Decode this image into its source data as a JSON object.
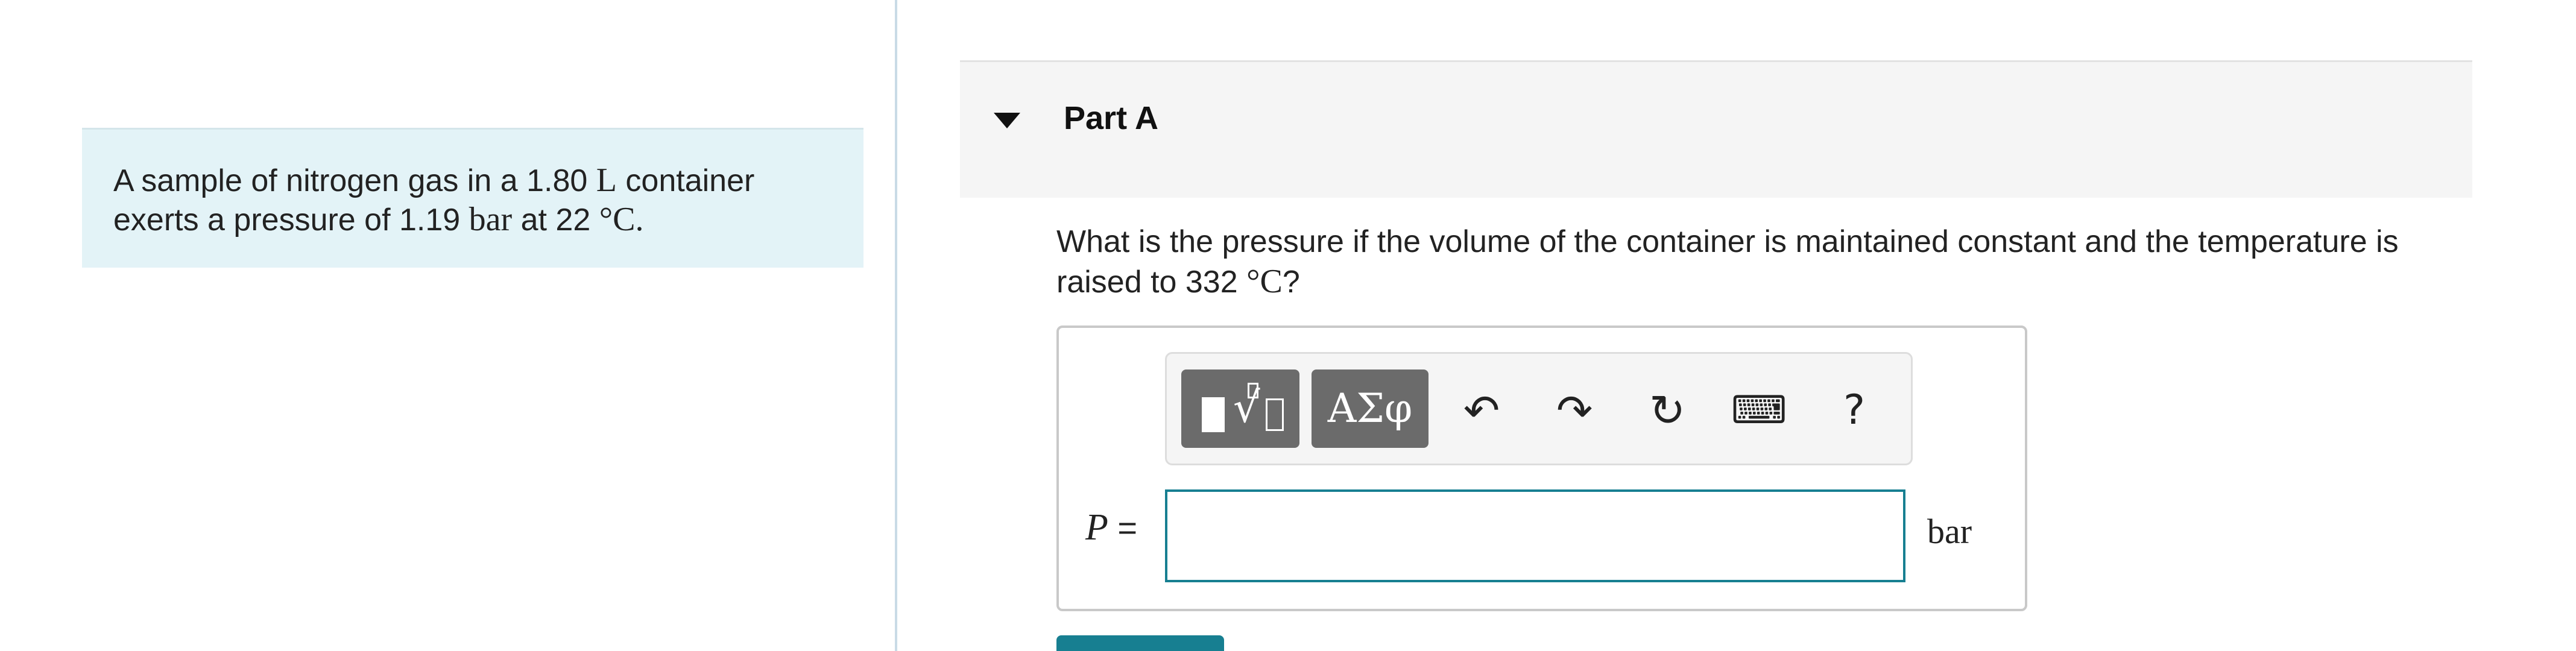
{
  "problem": {
    "line1_prefix": "A sample of nitrogen gas in a 1.80 ",
    "line1_unit": "L",
    "line1_suffix": " container",
    "line2_prefix": "exerts a pressure of 1.19 ",
    "line2_unit": "bar",
    "line2_mid": " at 22 ",
    "line2_temp_unit": "°C",
    "line2_suffix": "."
  },
  "part": {
    "title": "Part A",
    "question_prefix": "What is the pressure if the volume of the container is maintained constant and the temperature is raised to 332 ",
    "question_unit": "°C",
    "question_suffix": "?"
  },
  "toolbar": {
    "greek_label": "ΑΣφ",
    "undo_glyph": "↶",
    "redo_glyph": "↷",
    "reset_glyph": "↻",
    "keyboard_glyph": "⌨",
    "help_label": "?"
  },
  "answer": {
    "variable": "P",
    "equals": " =",
    "value": "",
    "unit": "bar"
  },
  "icons": {
    "collapse": "caret-down-icon",
    "template": "template-icon",
    "undo": "undo-icon",
    "redo": "redo-icon",
    "reset": "reset-icon",
    "keyboard": "keyboard-icon",
    "help": "help-icon"
  },
  "colors": {
    "accent": "#177f91",
    "problem_bg": "#e3f3f7",
    "header_bg": "#f5f5f5",
    "toolbar_button": "#6b6b6b"
  }
}
